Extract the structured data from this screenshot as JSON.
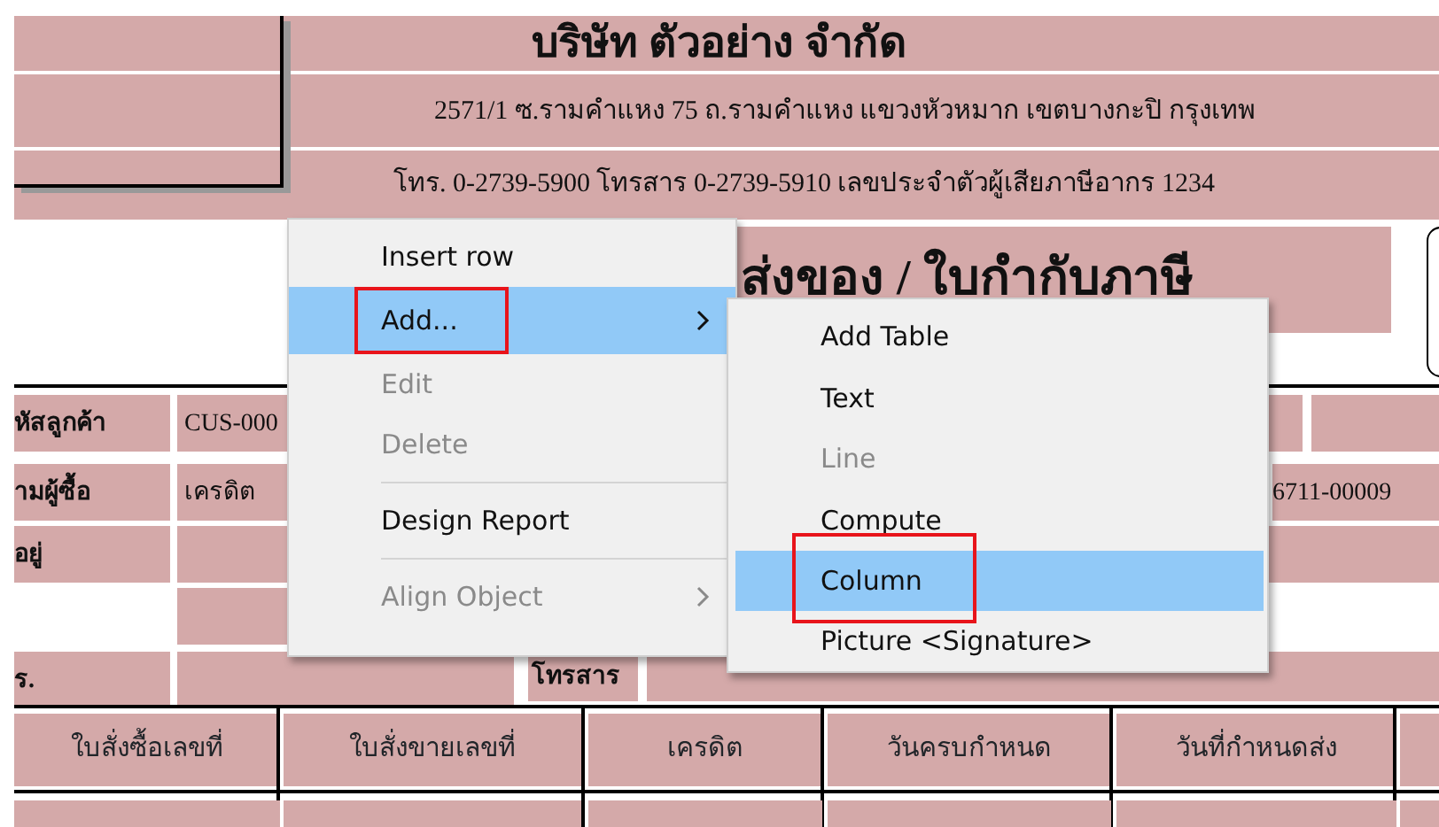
{
  "report": {
    "company_title": "บริษัท ตัวอย่าง จำกัด",
    "address": "2571/1 ซ.รามคำแหง 75 ถ.รามคำแหง แขวงหัวหมาก เขตบางกะปิ กรุงเทพ",
    "phone_line": "โทร. 0-2739-5900   โทรสาร 0-2739-5910   เลขประจำตัวผู้เสียภาษีอากร 1234",
    "doc_title": "ส่งของ / ใบกำกับภาษี",
    "fields": [
      {
        "label": "หัสลูกค้า",
        "value": "CUS-000"
      },
      {
        "label": "ามผู้ซื้อ",
        "value": "เครดิต"
      },
      {
        "label": "อยู่"
      },
      {
        "label": "ร."
      }
    ],
    "right_fields": [
      "6711-00009"
    ],
    "fax_label": "โทรสาร",
    "columns": [
      "ใบสั่งซื้อเลขที่",
      "ใบสั่งขายเลขที่",
      "เครดิต",
      "วันครบกำหนด",
      "วันที่กำหนดส่ง"
    ]
  },
  "context_menu": {
    "items": [
      {
        "kind": "item",
        "label": "Insert row",
        "disabled": false,
        "selected": false,
        "submenu": false,
        "outlined": false
      },
      {
        "kind": "item",
        "label": "Add...",
        "disabled": false,
        "selected": true,
        "submenu": true,
        "outlined": true
      },
      {
        "kind": "item",
        "label": "Edit",
        "disabled": true,
        "selected": false,
        "submenu": false,
        "outlined": false
      },
      {
        "kind": "item",
        "label": "Delete",
        "disabled": true,
        "selected": false,
        "submenu": false,
        "outlined": false
      },
      {
        "kind": "separator"
      },
      {
        "kind": "item",
        "label": "Design Report",
        "disabled": false,
        "selected": false,
        "submenu": false,
        "outlined": false
      },
      {
        "kind": "separator"
      },
      {
        "kind": "item",
        "label": "Align Object",
        "disabled": true,
        "selected": false,
        "submenu": true,
        "outlined": false
      }
    ]
  },
  "submenu": {
    "items": [
      {
        "label": "Add Table",
        "disabled": false,
        "selected": false,
        "outlined": false
      },
      {
        "label": "Text",
        "disabled": false,
        "selected": false,
        "outlined": false
      },
      {
        "label": "Line",
        "disabled": true,
        "selected": false,
        "outlined": false
      },
      {
        "label": "Compute",
        "disabled": false,
        "selected": false,
        "outlined": false
      },
      {
        "label": "Column",
        "disabled": false,
        "selected": true,
        "outlined": true
      },
      {
        "label": "Picture <Signature>",
        "disabled": false,
        "selected": false,
        "outlined": false
      }
    ]
  }
}
